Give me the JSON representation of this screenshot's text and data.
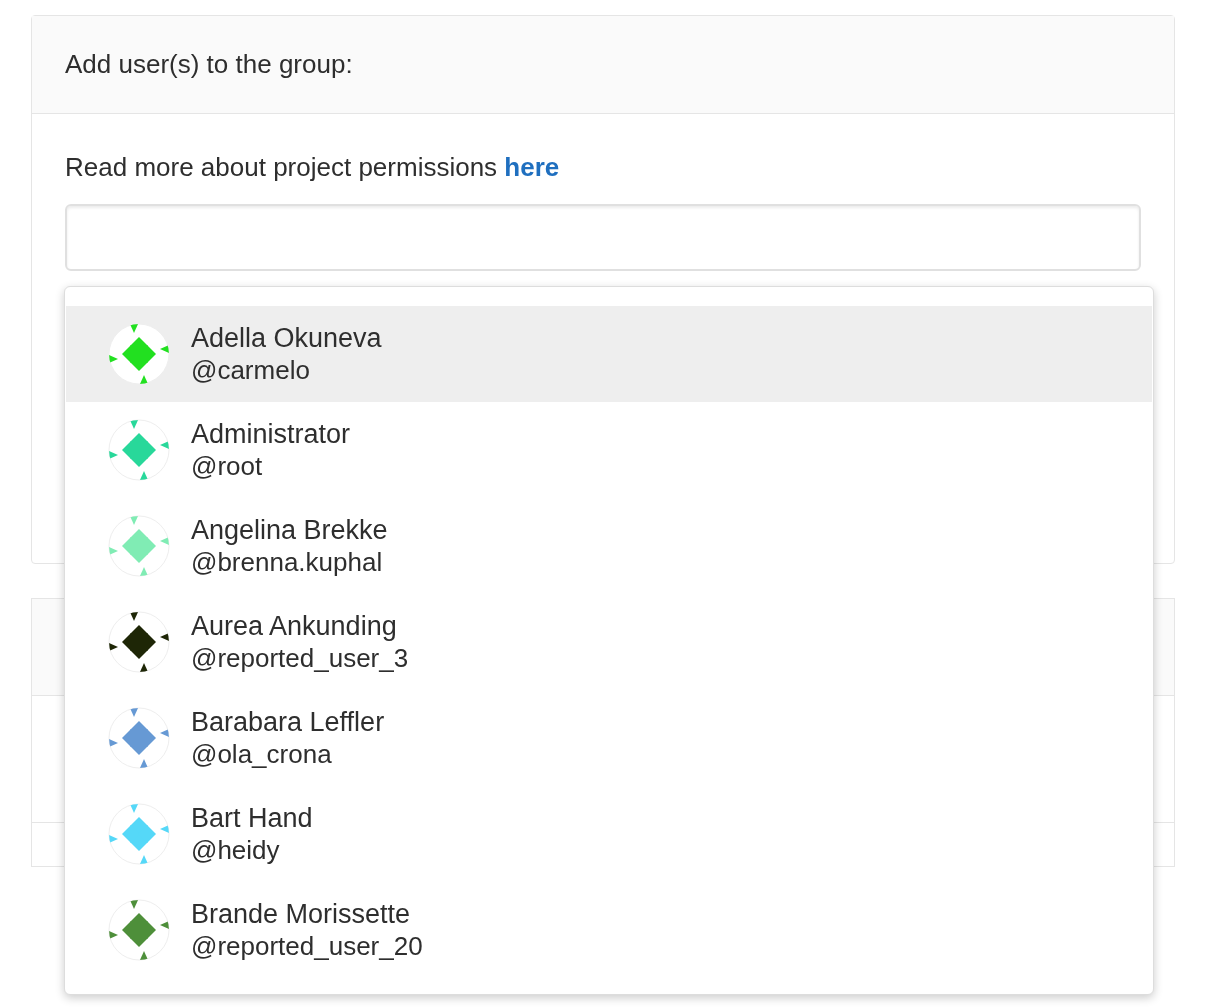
{
  "panel": {
    "title": "Add user(s) to the group:",
    "intro": "Read more about project permissions **here**"
  },
  "dropdown": {
    "users": [
      {
        "name": "Adella Okuneva",
        "username": "@carmelo",
        "color": "#22e020",
        "selected": true
      },
      {
        "name": "Administrator",
        "username": "@root",
        "color": "#28d89a",
        "selected": false
      },
      {
        "name": "Angelina Brekke",
        "username": "@brenna.kuphal",
        "color": "#80ecb4",
        "selected": false
      },
      {
        "name": "Aurea Ankunding",
        "username": "@reported_user_3",
        "color": "#1e2606",
        "selected": false
      },
      {
        "name": "Barabara Leffler",
        "username": "@ola_crona",
        "color": "#6699d4",
        "selected": false
      },
      {
        "name": "Bart Hand",
        "username": "@heidy",
        "color": "#55d8f8",
        "selected": false
      },
      {
        "name": "Brande Morissette",
        "username": "@reported_user_20",
        "color": "#4e8f3a",
        "selected": false
      }
    ]
  }
}
